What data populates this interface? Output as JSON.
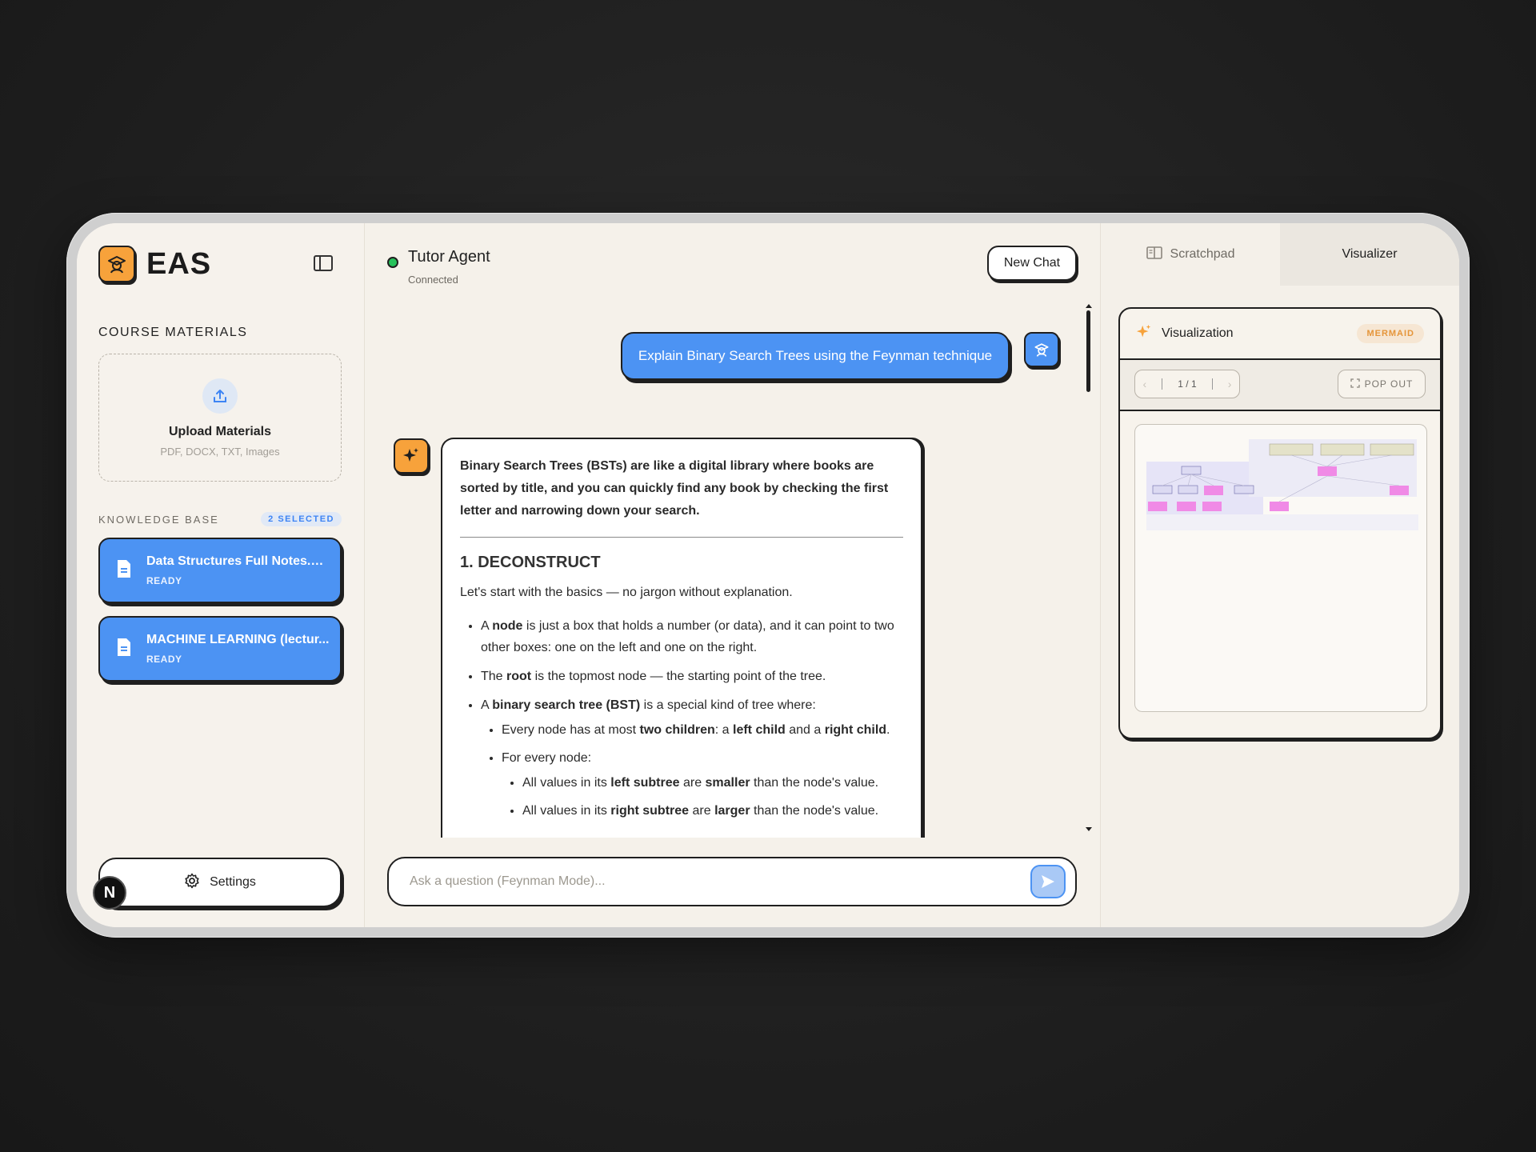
{
  "brand": {
    "name": "EAS",
    "logo_icon": "graduate-icon",
    "accent": "#f7a23b"
  },
  "sidebar": {
    "course_materials_title": "COURSE MATERIALS",
    "upload": {
      "title": "Upload Materials",
      "subtitle": "PDF, DOCX, TXT, Images"
    },
    "knowledge_base": {
      "title": "KNOWLEDGE BASE",
      "badge": "2 SELECTED",
      "files": [
        {
          "name": "Data Structures Full Notes.pdf",
          "status": "READY"
        },
        {
          "name": "MACHINE LEARNING (lectur...",
          "status": "READY"
        }
      ]
    },
    "settings_label": "Settings",
    "next_badge": "N"
  },
  "chat": {
    "agent_name": "Tutor Agent",
    "agent_status": "Connected",
    "new_chat_label": "New Chat",
    "user_message": "Explain Binary Search Trees using the Feynman technique",
    "bot": {
      "intro": "Binary Search Trees (BSTs) are like a digital library where books are sorted by title, and you can quickly find any book by checking the first letter and narrowing down your search.",
      "heading": "1. DECONSTRUCT",
      "paragraph": "Let's start with the basics — no jargon without explanation.",
      "b1": {
        "pre": "A ",
        "bold": "node",
        "post": " is just a box that holds a number (or data), and it can point to two other boxes: one on the left and one on the right."
      },
      "b2": {
        "pre": "The ",
        "bold": "root",
        "post": " is the topmost node — the starting point of the tree."
      },
      "b3": {
        "pre": "A ",
        "bold": "binary search tree (BST)",
        "post": " is a special kind of tree where:"
      },
      "s1": {
        "pre": "Every node has at most ",
        "bold1": "two children",
        "mid1": ": a ",
        "bold2": "left child",
        "mid2": " and a ",
        "bold3": "right child",
        "post": "."
      },
      "s2": {
        "text": "For every node:"
      },
      "ss1": {
        "pre": "All values in its ",
        "bold1": "left subtree",
        "mid": " are ",
        "bold2": "smaller",
        "post": " than the node's value."
      },
      "ss2": {
        "pre": "All values in its ",
        "bold1": "right subtree",
        "mid": " are ",
        "bold2": "larger",
        "post": " than the node's value."
      }
    },
    "input_placeholder": "Ask a question (Feynman Mode)..."
  },
  "right_panel": {
    "tabs": [
      {
        "label": "Scratchpad",
        "icon": "book-icon",
        "active": false
      },
      {
        "label": "Visualizer",
        "active": true
      }
    ],
    "visualization": {
      "title": "Visualization",
      "badge": "MERMAID",
      "pager": "1 / 1",
      "popout_label": "POP OUT"
    }
  }
}
